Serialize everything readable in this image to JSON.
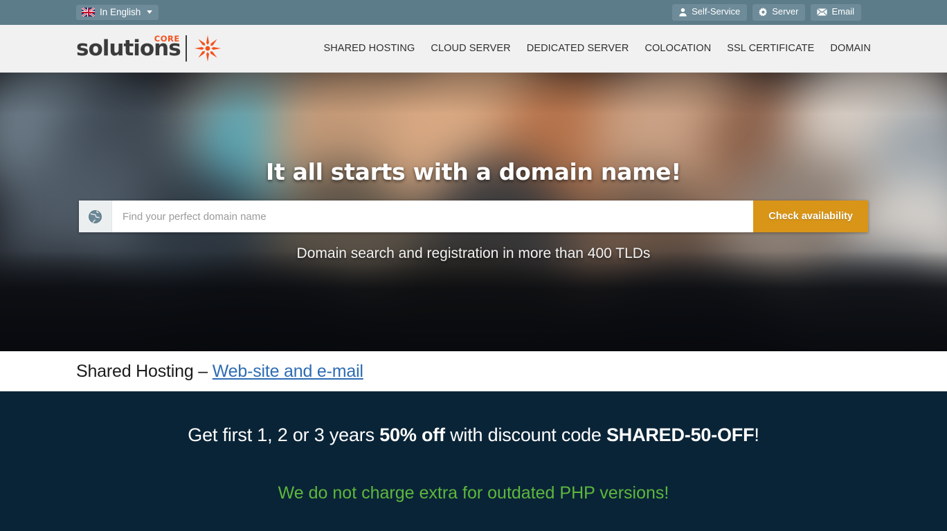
{
  "topbar": {
    "language_label": "In English",
    "language_icon": "uk-flag-icon",
    "caret_icon": "chevron-down-icon",
    "actions": [
      {
        "label": "Self-Service",
        "icon": "user-icon"
      },
      {
        "label": "Server",
        "icon": "gear-icon"
      },
      {
        "label": "Email",
        "icon": "envelope-icon"
      }
    ],
    "bg_color": "#5d7c8a",
    "button_color": "#6d8b99"
  },
  "header": {
    "logo": {
      "word": "solutions",
      "superscript": "CORE",
      "mark_icon": "starburst-icon",
      "accent_color": "#f4511e"
    },
    "nav": [
      {
        "label": "SHARED HOSTING"
      },
      {
        "label": "CLOUD SERVER"
      },
      {
        "label": "DEDICATED SERVER"
      },
      {
        "label": "COLOCATION"
      },
      {
        "label": "SSL CERTIFICATE"
      },
      {
        "label": "DOMAIN"
      }
    ],
    "bg_color": "#f1f1f1"
  },
  "hero": {
    "title": "It all starts with a domain name!",
    "search": {
      "icon": "globe-icon",
      "placeholder": "Find your perfect domain name",
      "value": "",
      "button_label": "Check availability",
      "button_color": "#d99518"
    },
    "subtitle": "Domain search and registration in more than 400 TLDs",
    "background": "blurred-crowd-photo"
  },
  "section": {
    "heading_prefix": "Shared Hosting – ",
    "heading_link": "Web-site and e-mail",
    "link_color": "#2d6cb5"
  },
  "promo": {
    "line1_part1": "Get first 1, 2 or 3 years ",
    "line1_bold1": "50% off",
    "line1_part2": " with discount code ",
    "line1_bold2": "SHARED-50-OFF",
    "line1_part3": "!",
    "line2": "We do not charge extra for outdated PHP versions!",
    "bg_color": "#0a2437",
    "highlight_color": "#5cb83c"
  }
}
